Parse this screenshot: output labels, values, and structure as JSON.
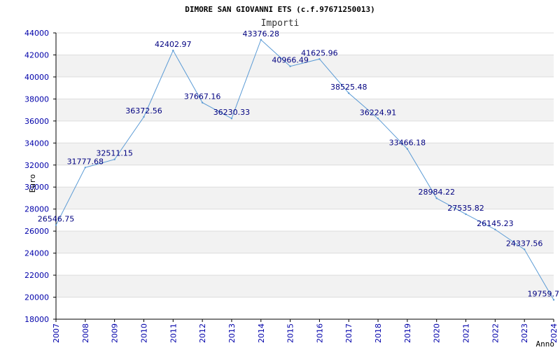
{
  "chart_data": {
    "type": "line",
    "title": "DIMORE SAN GIOVANNI ETS (c.f.97671250013)",
    "subtitle": "Importi",
    "xlabel": "Anno",
    "ylabel": "Euro",
    "x": [
      "2007",
      "2008",
      "2009",
      "2010",
      "2011",
      "2012",
      "2013",
      "2014",
      "2015",
      "2016",
      "2017",
      "2018",
      "2019",
      "2020",
      "2021",
      "2022",
      "2023",
      "2024"
    ],
    "values": [
      26546.75,
      31777.68,
      32511.15,
      36372.56,
      42402.97,
      37667.16,
      36230.33,
      43376.28,
      40966.49,
      41625.96,
      38525.48,
      36224.91,
      33466.18,
      28984.22,
      27535.82,
      26145.23,
      24337.56,
      19759.7
    ],
    "labels": [
      "26546.75",
      "31777.68",
      "32511.15",
      "36372.56",
      "42402.97",
      "37667.16",
      "36230.33",
      "43376.28",
      "40966.49",
      "41625.96",
      "38525.48",
      "36224.91",
      "33466.18",
      "28984.22",
      "27535.82",
      "26145.23",
      "24337.56",
      "19759.7"
    ],
    "ylim": [
      18000,
      44000
    ],
    "ystep": 2000,
    "grid": true,
    "colors": {
      "line": "#5b9bd5",
      "band": "#f2f2f2",
      "grid": "#dddddd",
      "ticks": "#0000aa",
      "labels": "#000080"
    }
  }
}
